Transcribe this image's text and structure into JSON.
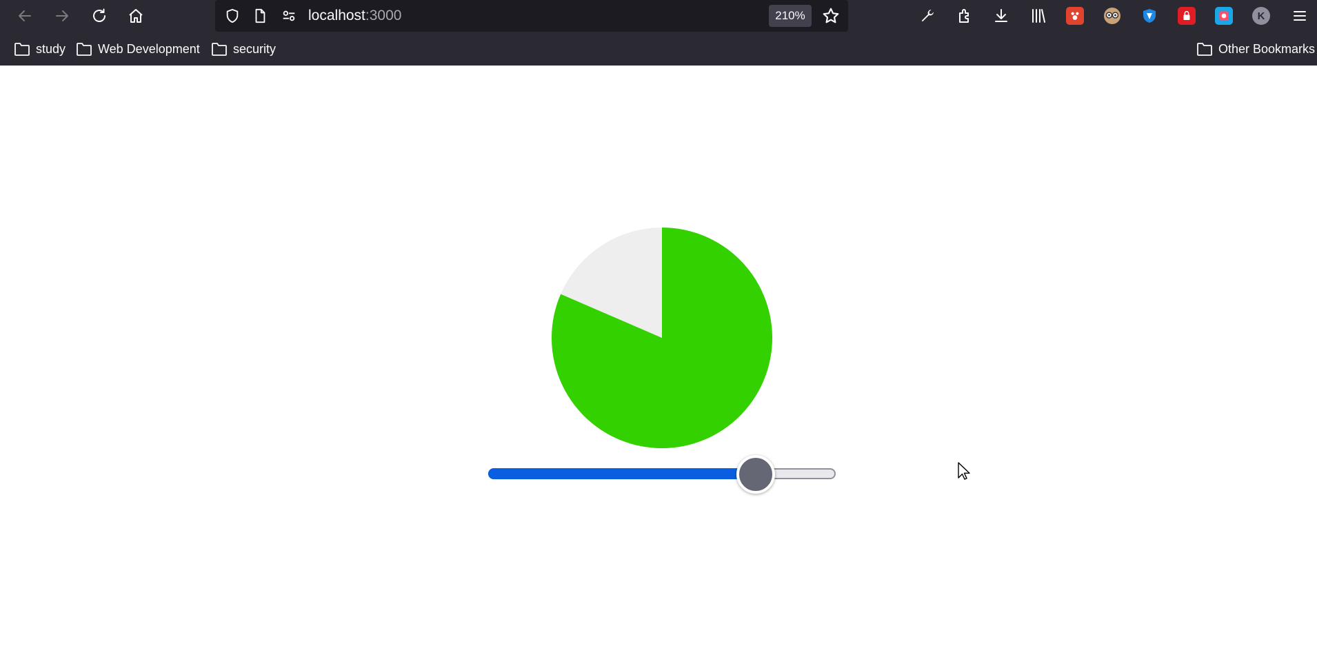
{
  "toolbar": {
    "nav": [
      {
        "icon": "back-arrow-icon",
        "enabled": false
      },
      {
        "icon": "forward-arrow-icon",
        "enabled": false
      },
      {
        "icon": "reload-icon",
        "enabled": true
      },
      {
        "icon": "home-icon",
        "enabled": true
      }
    ],
    "url": {
      "host": "localhost",
      "port": ":3000"
    },
    "zoom": "210%",
    "right_icons": [
      "wrench-icon",
      "extensions-icon",
      "download-icon",
      "library-icon",
      "profile-icon",
      "app-menu-icon"
    ],
    "extensions": [
      "red-paw-extension-icon",
      "glasses-extension-icon",
      "blue-shield-extension-icon",
      "red-lock-extension-icon",
      "cyan-camera-extension-icon"
    ],
    "profile_initial": "K"
  },
  "bookmarks": {
    "items": [
      "study",
      "Web Development",
      "security"
    ],
    "other": "Other Bookmarks"
  },
  "pie": {
    "value_fraction": 0.815,
    "fill_color": "#33d100",
    "remainder_color": "#eeeeee"
  },
  "slider": {
    "value_fraction": 0.77,
    "fill_color": "#0a5fe0",
    "thumb_color": "#656874"
  }
}
